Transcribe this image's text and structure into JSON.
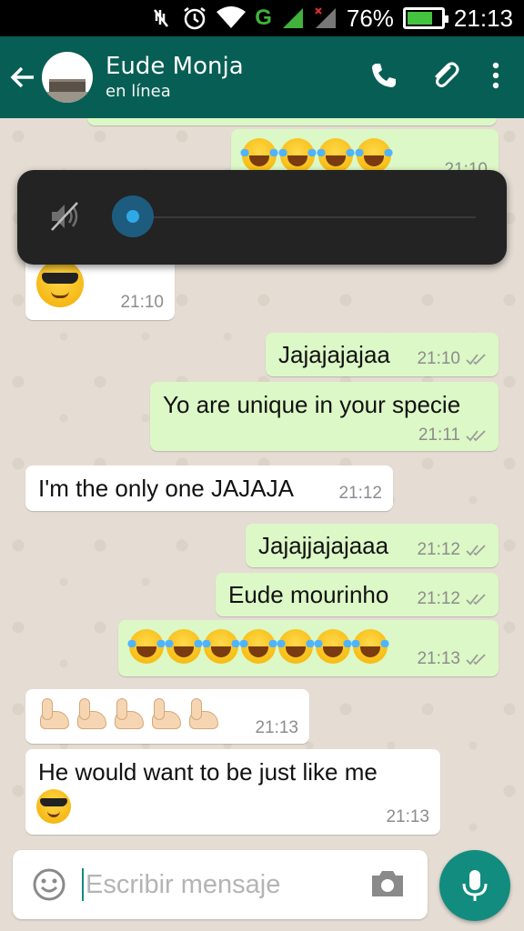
{
  "status_bar": {
    "battery": "76%",
    "time": "21:13",
    "network": "G"
  },
  "header": {
    "contact_name": "Eude Monja",
    "contact_status": "en línea"
  },
  "volume_overlay": {
    "level": 0
  },
  "messages": [
    {
      "dir": "out",
      "content": "emoji",
      "emoji": "joy",
      "count": 4,
      "time": "21:10"
    },
    {
      "dir": "in",
      "content": "emoji",
      "emoji": "sunglasses",
      "count": 1,
      "time": "21:10"
    },
    {
      "dir": "out",
      "text": "Jajajajajaa",
      "time": "21:10"
    },
    {
      "dir": "out",
      "text": "Yo are unique in your specie",
      "time": "21:11"
    },
    {
      "dir": "in",
      "text": "I'm the only one JAJAJA",
      "time": "21:12"
    },
    {
      "dir": "out",
      "text": "Jajajjajajaaa",
      "time": "21:12"
    },
    {
      "dir": "out",
      "text": "Eude mourinho",
      "time": "21:12"
    },
    {
      "dir": "out",
      "content": "emoji",
      "emoji": "joy",
      "count": 7,
      "time": "21:13"
    },
    {
      "dir": "in",
      "content": "emoji",
      "emoji": "flexed-biceps",
      "count": 5,
      "time": "21:13"
    },
    {
      "dir": "in",
      "text": "He would want to be just like me",
      "emoji": "sunglasses",
      "time": "21:13"
    }
  ],
  "input": {
    "placeholder": "Escribir mensaje"
  },
  "colors": {
    "header": "#075e54",
    "outgoing_bubble": "#dcf8c6",
    "incoming_bubble": "#ffffff",
    "fab": "#128c7e",
    "chat_bg": "#e5ddd4"
  }
}
